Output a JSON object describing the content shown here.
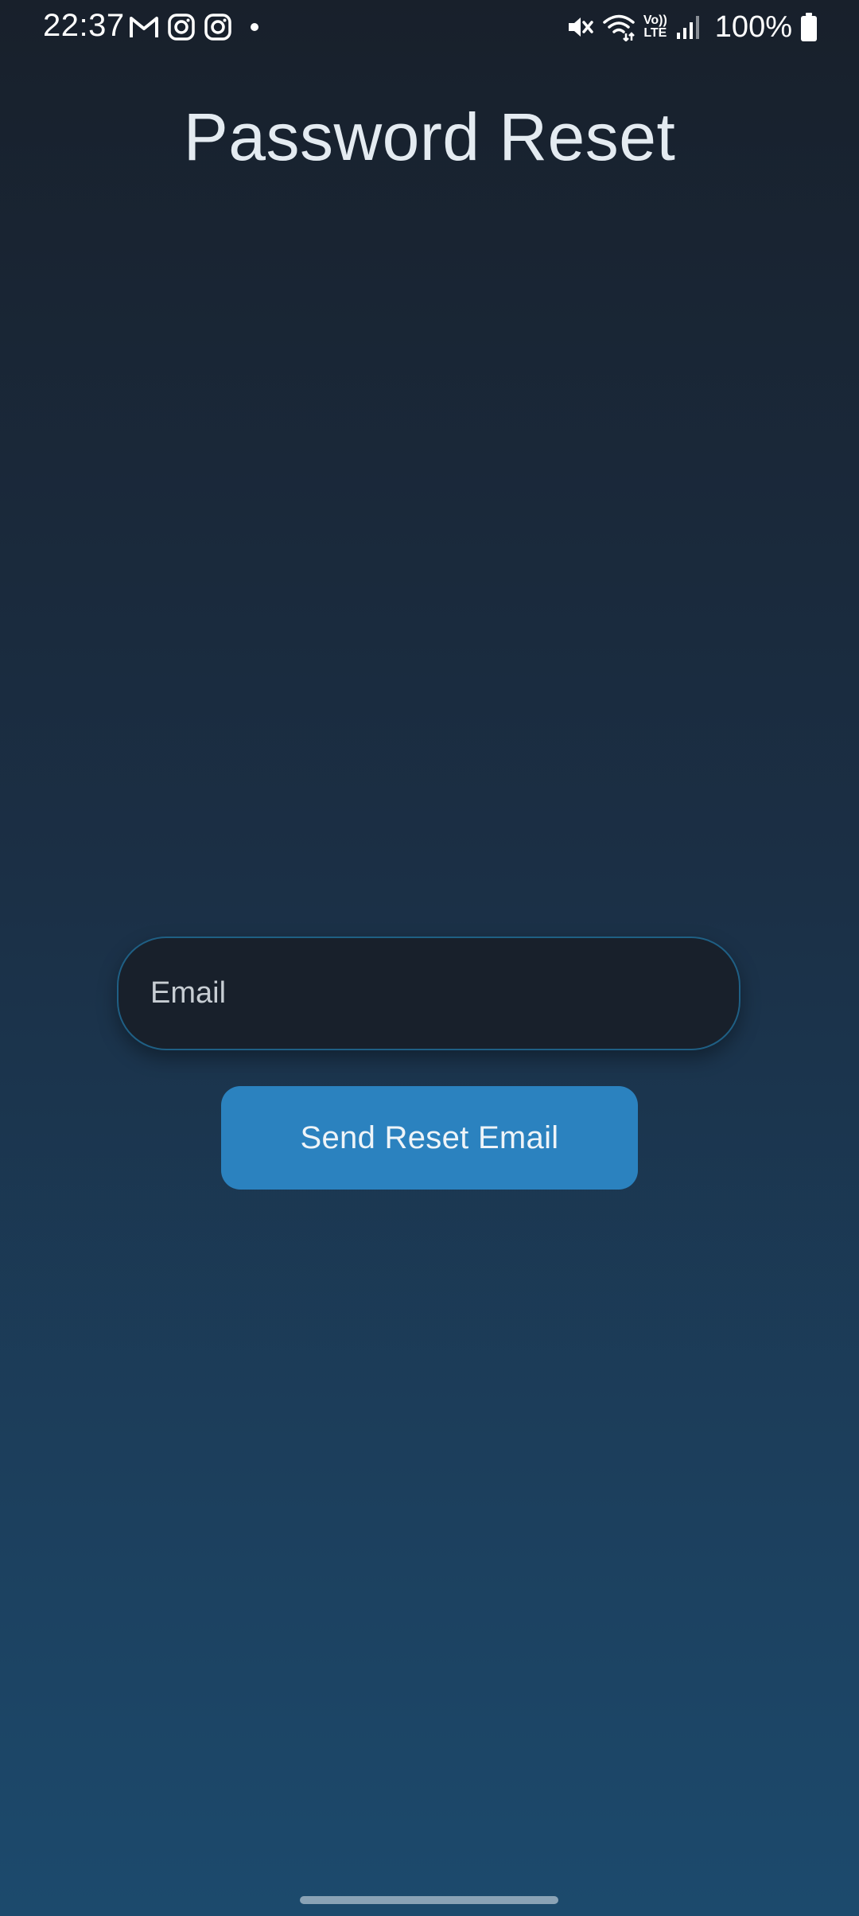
{
  "status_bar": {
    "time": "22:37",
    "left_icons": [
      "gmail-icon",
      "instagram-icon",
      "instagram-icon",
      "dot-icon"
    ],
    "right_icons": [
      "mute-icon",
      "wifi-icon",
      "volte-icon",
      "signal-icon",
      "battery-icon"
    ],
    "volte_label_top": "Vo))",
    "volte_label_bottom": "LTE",
    "battery_text": "100%"
  },
  "page": {
    "title": "Password Reset"
  },
  "form": {
    "email_placeholder": "Email",
    "email_value": "",
    "submit_label": "Send Reset Email"
  },
  "colors": {
    "background_top": "#18202b",
    "background_bottom": "#1c4a6d",
    "button": "#2b82bf",
    "input_background": "#18202b",
    "input_border": "#1f5f84"
  }
}
